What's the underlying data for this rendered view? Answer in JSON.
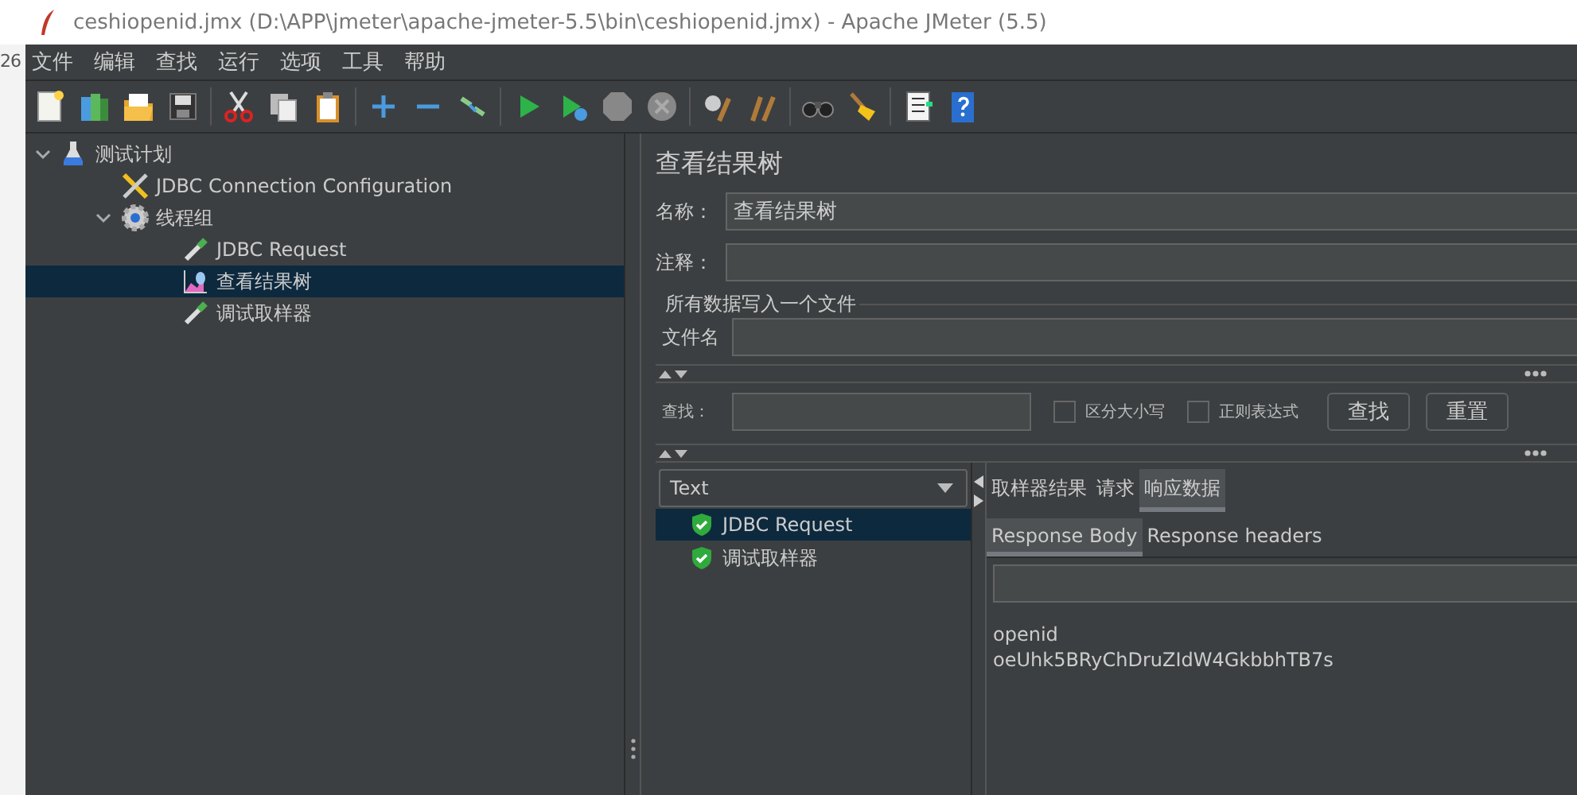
{
  "window": {
    "title": "ceshiopenid.jmx (D:\\APP\\jmeter\\apache-jmeter-5.5\\bin\\ceshiopenid.jmx) - Apache JMeter (5.5)"
  },
  "background_window": {
    "text": "26"
  },
  "menu": [
    {
      "label": "文件"
    },
    {
      "label": "编辑"
    },
    {
      "label": "查找"
    },
    {
      "label": "运行"
    },
    {
      "label": "选项"
    },
    {
      "label": "工具"
    },
    {
      "label": "帮助"
    }
  ],
  "tree": [
    {
      "label": "测试计划",
      "kind": "plan",
      "expanded": true,
      "selected": false,
      "children": [
        {
          "label": "JDBC Connection Configuration",
          "kind": "config",
          "selected": false
        },
        {
          "label": "线程组",
          "kind": "threads",
          "expanded": true,
          "selected": false,
          "children": [
            {
              "label": "JDBC Request",
              "kind": "sampler",
              "selected": false
            },
            {
              "label": "查看结果树",
              "kind": "listener",
              "selected": true
            },
            {
              "label": "调试取样器",
              "kind": "sampler",
              "selected": false
            }
          ]
        }
      ]
    }
  ],
  "panel": {
    "title": "查看结果树",
    "name_label": "名称：",
    "name_value": "查看结果树",
    "comment_label": "注释：",
    "file_group": "所有数据写入一个文件",
    "file_label": "文件名"
  },
  "search": {
    "label": "查找：",
    "options": [
      {
        "label": "区分大小写",
        "checked": false
      },
      {
        "label": "正则表达式",
        "checked": false
      }
    ],
    "buttons": [
      "查找",
      "重置"
    ]
  },
  "results": {
    "renderer": "Text",
    "samples": [
      {
        "label": "JDBC Request",
        "selected": true,
        "success": true
      },
      {
        "label": "调试取样器",
        "selected": false,
        "success": true
      }
    ],
    "tabs": [
      {
        "label": "取样器结果",
        "selected": false
      },
      {
        "label": "请求",
        "selected": false
      },
      {
        "label": "响应数据",
        "selected": true
      }
    ],
    "subtabs": [
      {
        "label": "Response Body",
        "selected": true
      },
      {
        "label": "Response headers",
        "selected": false
      }
    ],
    "body": [
      "openid",
      "oeUhk5BRyChDruZIdW4GkbbhTB7s"
    ]
  }
}
